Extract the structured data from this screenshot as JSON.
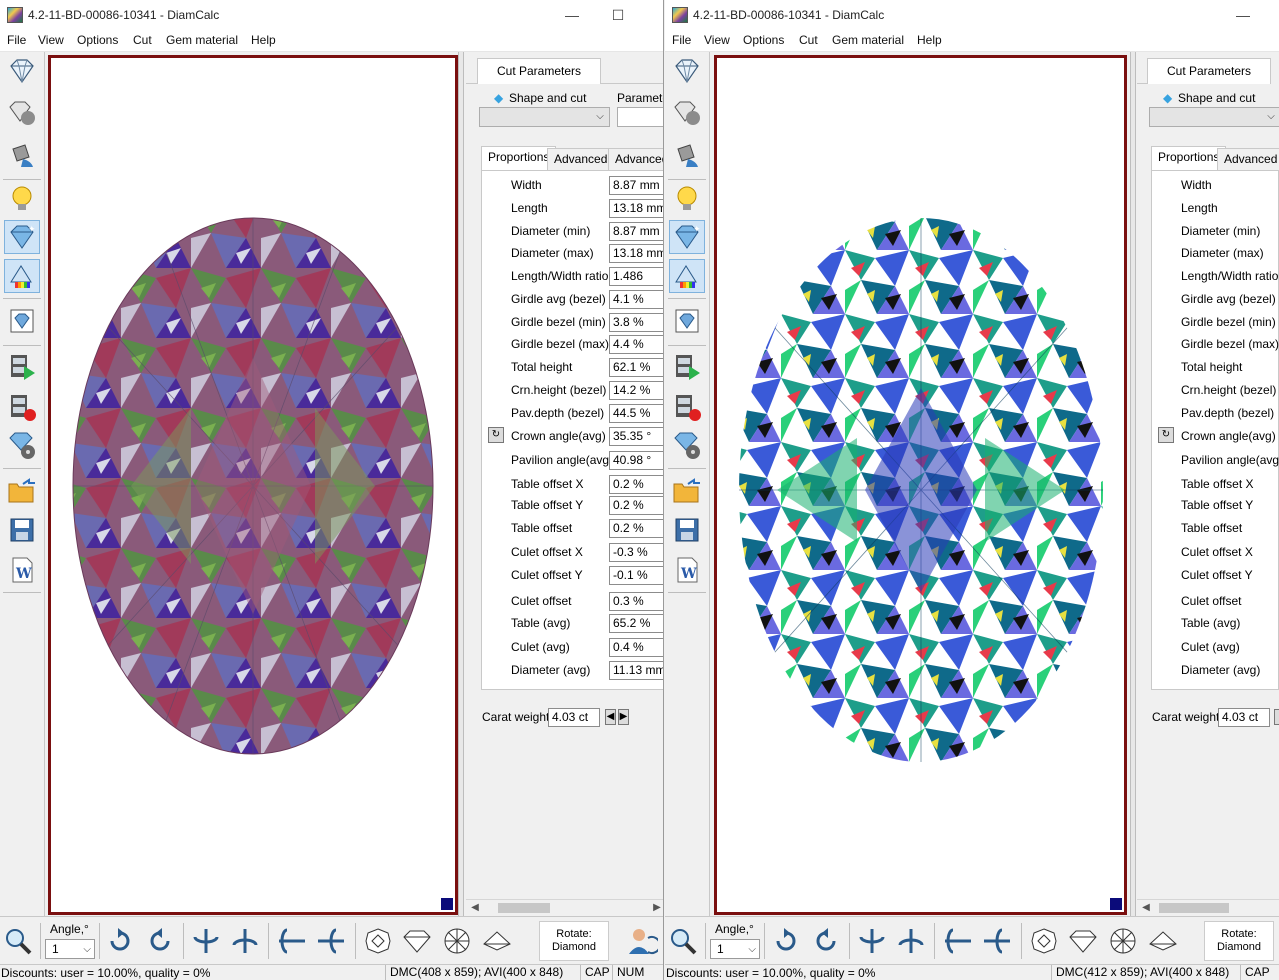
{
  "left_window": {
    "title": "4.2-11-BD-00086-10341 - DiamCalc",
    "menu": [
      "File",
      "View",
      "Options",
      "Cut",
      "Gem material",
      "Help"
    ],
    "panel": {
      "top_tab": "Cut Parameters",
      "shape_label": "Shape and cut",
      "param_label": "Parameter",
      "subtabs": [
        "Proportions",
        "Advanced",
        "Advanced"
      ],
      "rows": [
        {
          "label": "Width",
          "value": "8.87 mm"
        },
        {
          "label": "Length",
          "value": "13.18 mm"
        },
        {
          "label": "Diameter (min)",
          "value": "8.87 mm"
        },
        {
          "label": "Diameter (max)",
          "value": "13.18 mm"
        },
        {
          "label": "Length/Width ratio",
          "value": "1.486"
        },
        {
          "label": "Girdle avg (bezel)",
          "value": "4.1 %"
        },
        {
          "label": "Girdle bezel (min)",
          "value": "3.8 %"
        },
        {
          "label": "Girdle bezel (max)",
          "value": "4.4 %"
        },
        {
          "label": "Total height",
          "value": "62.1 %"
        },
        {
          "label": "Crn.height (bezel)",
          "value": "14.2 %"
        },
        {
          "label": "Pav.depth (bezel)",
          "value": "44.5 %"
        },
        {
          "label": "Crown angle(avg)",
          "value": "35.35 °"
        },
        {
          "label": "Pavilion angle(avg)",
          "value": "40.98 °"
        },
        {
          "label": "Table offset X",
          "value": "0.2 %"
        },
        {
          "label": "Table offset Y",
          "value": "0.2 %"
        },
        {
          "label": "Table offset",
          "value": "0.2 %"
        },
        {
          "label": "Culet offset X",
          "value": "-0.3 %"
        },
        {
          "label": "Culet offset Y",
          "value": "-0.1 %"
        },
        {
          "label": "Culet offset",
          "value": "0.3 %"
        },
        {
          "label": "Table (avg)",
          "value": "65.2 %"
        },
        {
          "label": "Culet (avg)",
          "value": "0.4 %"
        },
        {
          "label": "Diameter (avg)",
          "value": "11.13 mm"
        }
      ],
      "carat_label": "Carat weight",
      "carat_value": "4.03 ct"
    },
    "bottom": {
      "angle_label": "Angle,°",
      "angle_value": "1",
      "rotate_label": "Rotate:",
      "rotate_value": "Diamond"
    },
    "status": {
      "discounts": "Discounts: user = 10.00%, quality = 0%",
      "dmc": "DMC(408 x 859); AVI(400 x 848)",
      "cap": "CAP",
      "num": "NUM"
    }
  },
  "right_window": {
    "title": "4.2-11-BD-00086-10341 - DiamCalc",
    "menu": [
      "File",
      "View",
      "Options",
      "Cut",
      "Gem material",
      "Help"
    ],
    "panel": {
      "top_tab": "Cut Parameters",
      "shape_label": "Shape and cut",
      "subtabs": [
        "Proportions",
        "Advanced"
      ],
      "rows": [
        {
          "label": "Width"
        },
        {
          "label": "Length"
        },
        {
          "label": "Diameter (min)"
        },
        {
          "label": "Diameter (max)"
        },
        {
          "label": "Length/Width ratio"
        },
        {
          "label": "Girdle avg (bezel)"
        },
        {
          "label": "Girdle bezel (min)"
        },
        {
          "label": "Girdle bezel (max)"
        },
        {
          "label": "Total height"
        },
        {
          "label": "Crn.height (bezel)"
        },
        {
          "label": "Pav.depth (bezel)"
        },
        {
          "label": "Crown angle(avg)"
        },
        {
          "label": "Pavilion angle(avg)"
        },
        {
          "label": "Table offset X"
        },
        {
          "label": "Table offset Y"
        },
        {
          "label": "Table offset"
        },
        {
          "label": "Culet offset X"
        },
        {
          "label": "Culet offset Y"
        },
        {
          "label": "Culet offset"
        },
        {
          "label": "Table (avg)"
        },
        {
          "label": "Culet (avg)"
        },
        {
          "label": "Diameter (avg)"
        }
      ],
      "carat_label": "Carat weight",
      "carat_value": "4.03 ct"
    },
    "bottom": {
      "angle_label": "Angle,°",
      "angle_value": "1",
      "rotate_label": "Rotate:",
      "rotate_value": "Diamond"
    },
    "status": {
      "discounts": "Discounts: user = 10.00%, quality = 0%",
      "dmc": "DMC(412 x 859); AVI(400 x 848)",
      "cap": "CAP"
    }
  },
  "toolbar_icons": [
    "diamond-icon",
    "sphere-diamond-icon",
    "paint-bucket-icon",
    "light-bulb-icon",
    "diamond-sparkle-icon",
    "spectrum-icon",
    "image-frame-icon",
    "film-play-icon",
    "film-record-icon",
    "diamond-reel-icon",
    "open-folder-icon",
    "save-icon",
    "word-doc-icon"
  ],
  "bottom_icons": [
    "zoom-icon",
    "rotate-cw-icon",
    "rotate-ccw-icon",
    "flip-vertical-icon",
    "flip-vertical-2-icon",
    "flip-horizontal-icon",
    "flip-horizontal-2-icon",
    "top-view-icon",
    "side-view-icon",
    "bottom-view-icon",
    "profile-view-icon"
  ],
  "colors": {
    "view_border": "#7a0f0f",
    "corner_marker": "#0b0b7a",
    "active_tool": "#cfe4f7"
  }
}
